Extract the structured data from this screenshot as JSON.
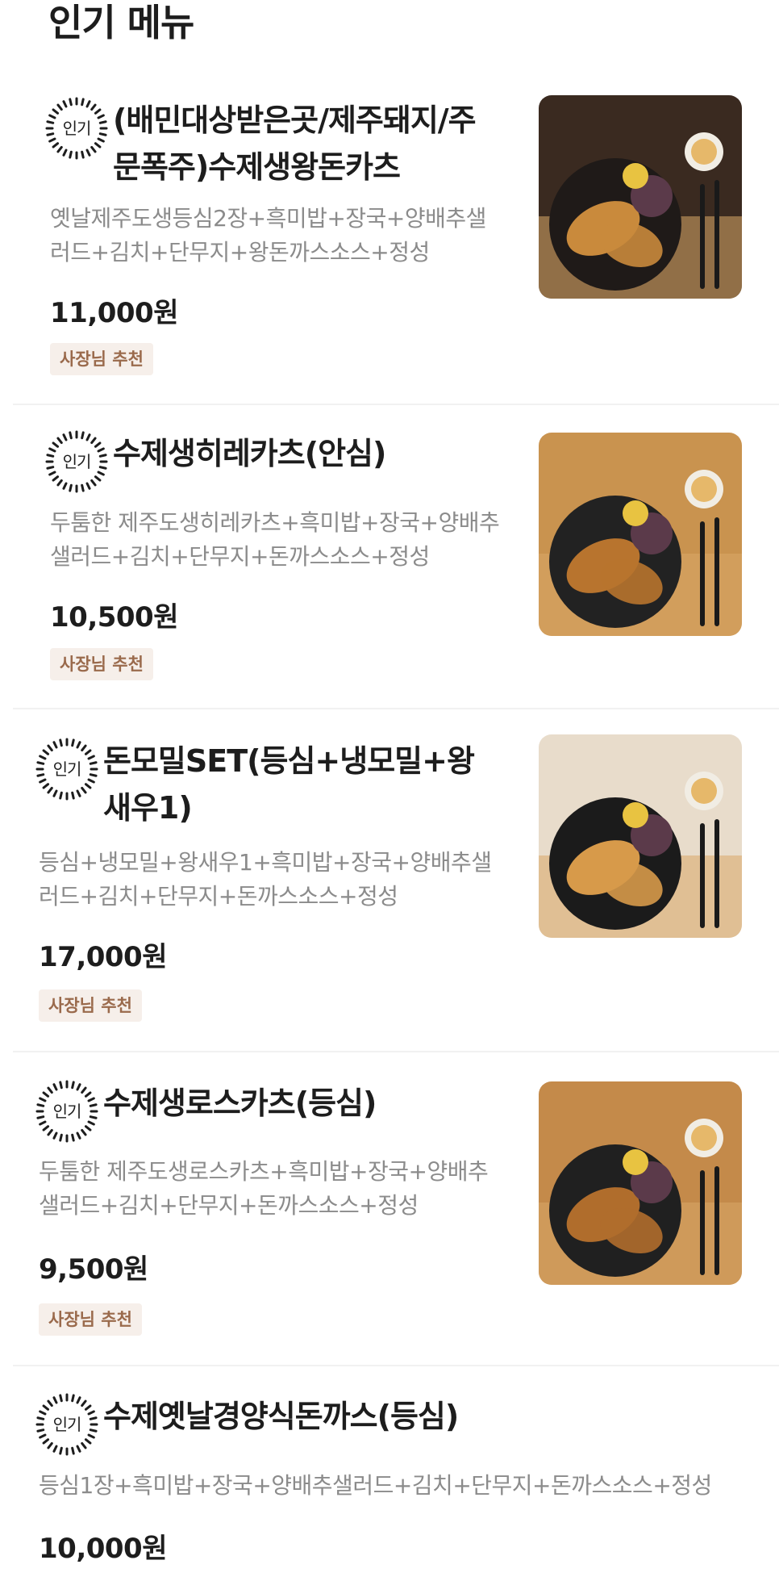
{
  "section": {
    "title": "인기 메뉴"
  },
  "badge_label": "인기",
  "items": [
    {
      "name": "(배민대상받은곳/제주돼지/주문폭주)수제생왕돈카츠",
      "name_lines": [
        "(배민대상받은곳/제주돼지/주",
        "문폭주)수제생왕돈카츠"
      ],
      "desc_lines": [
        "옛날제주도생등심2장+흑미밥+장국+양배추샐",
        "러드+김치+단무지+왕돈까스소스+정성"
      ],
      "price": "11,000원",
      "tag": "사장님 추천",
      "photo": {
        "tint": "#3a2a20",
        "plate": "#1f1a18",
        "food": "#c98a3c"
      }
    },
    {
      "name": "수제생히레카츠(안심)",
      "name_lines": [
        "수제생히레카츠(안심)"
      ],
      "desc_lines": [
        "두툼한 제주도생히레카츠+흑미밥+장국+양배추",
        "샐러드+김치+단무지+돈까스소스+정성"
      ],
      "price": "10,500원",
      "tag": "사장님 추천",
      "photo": {
        "tint": "#c9934f",
        "plate": "#222",
        "food": "#b8742e"
      }
    },
    {
      "name": "돈모밀SET(등심+냉모밀+왕새우1)",
      "name_lines": [
        "돈모밀SET(등심+냉모밀+왕",
        "새우1)"
      ],
      "desc_lines": [
        "등심+냉모밀+왕새우1+흑미밥+장국+양배추샐",
        "러드+김치+단무지+돈까스소스+정성"
      ],
      "price": "17,000원",
      "tag": "사장님 추천",
      "photo": {
        "tint": "#e8dccb",
        "plate": "#1b1b1b",
        "food": "#d79a4a"
      }
    },
    {
      "name": "수제생로스카츠(등심)",
      "name_lines": [
        "수제생로스카츠(등심)"
      ],
      "desc_lines": [
        "두툼한 제주도생로스카츠+흑미밥+장국+양배추",
        "샐러드+김치+단무지+돈까스소스+정성"
      ],
      "price": "9,500원",
      "tag": "사장님 추천",
      "photo": {
        "tint": "#c48a4a",
        "plate": "#202020",
        "food": "#b06d2c"
      }
    },
    {
      "name": "수제옛날경양식돈까스(등심)",
      "name_lines": [
        "수제옛날경양식돈까스(등심)"
      ],
      "desc_lines": [
        "등심1장+흑미밥+장국+양배추샐러드+김치+단무지+돈까스소스+정성"
      ],
      "price": "10,000원"
    }
  ]
}
